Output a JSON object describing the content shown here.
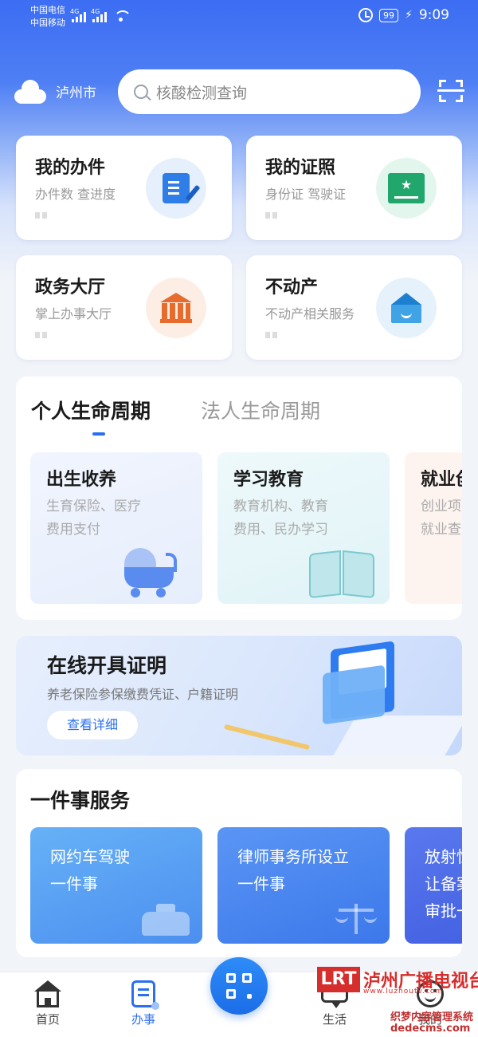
{
  "status_bar": {
    "carrier1": "中国电信",
    "carrier2": "中国移动",
    "net1": "4G",
    "net2": "4G",
    "battery": "99",
    "time": "9:09"
  },
  "header": {
    "city": "泸州市",
    "search_placeholder": "核酸检测查询"
  },
  "quick_cards": [
    {
      "title": "我的办件",
      "subtitle": "办件数 查进度"
    },
    {
      "title": "我的证照",
      "subtitle": "身份证 驾驶证"
    },
    {
      "title": "政务大厅",
      "subtitle": "掌上办事大厅"
    },
    {
      "title": "不动产",
      "subtitle": "不动产相关服务"
    }
  ],
  "lifecycle": {
    "tab_active": "个人生命周期",
    "tab_inactive": "法人生命周期",
    "items": [
      {
        "title": "出生收养",
        "line1": "生育保险、医疗",
        "line2": "费用支付"
      },
      {
        "title": "学习教育",
        "line1": "教育机构、教育",
        "line2": "费用、民办学习"
      },
      {
        "title": "就业创",
        "line1": "创业项",
        "line2": "就业查"
      }
    ]
  },
  "certificate_banner": {
    "title": "在线开具证明",
    "subtitle": "养老保险参保缴费凭证、户籍证明",
    "button": "查看详细"
  },
  "one_thing": {
    "title": "一件事服务",
    "items": [
      {
        "line1": "网约车驾驶",
        "line2": "一件事"
      },
      {
        "line1": "律师事务所设立",
        "line2": "一件事"
      },
      {
        "line1": "放射性",
        "line2": "让备案",
        "line3": "审批一"
      }
    ]
  },
  "tabbar": {
    "home": "首页",
    "banshi": "办事",
    "life": "生活",
    "mine": "我的"
  },
  "watermark": {
    "logo": "LRT",
    "name": "泸州广播电视台",
    "url": "www.luzhoutv.com",
    "line2": "织梦内容管理系统",
    "line3": "dedecms.com"
  },
  "colors": {
    "accent": "#2a6ff2",
    "header_blue": "#3c6df3"
  }
}
